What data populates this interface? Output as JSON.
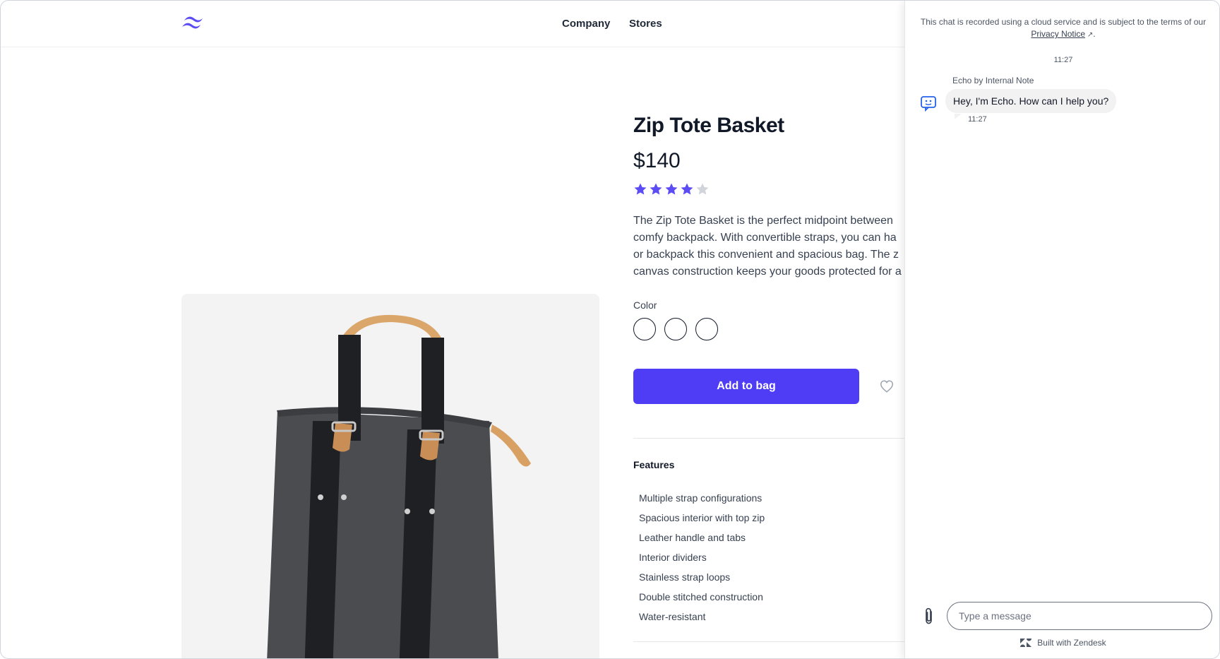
{
  "header": {
    "nav": [
      "Company",
      "Stores"
    ]
  },
  "product": {
    "title": "Zip Tote Basket",
    "price": "$140",
    "rating": 4,
    "rating_max": 5,
    "description_lines": [
      "The Zip Tote Basket is the perfect midpoint between",
      "comfy backpack. With convertible straps, you can ha",
      "or backpack this convenient and spacious bag. The z",
      "canvas construction keeps your goods protected for a"
    ],
    "color_label": "Color",
    "swatch_count": 3,
    "add_to_bag": "Add to bag",
    "features_title": "Features",
    "features": [
      "Multiple strap configurations",
      "Spacious interior with top zip",
      "Leather handle and tabs",
      "Interior dividers",
      "Stainless strap loops",
      "Double stitched construction",
      "Water-resistant"
    ],
    "icons": {
      "logo": "tailwind-logo-icon",
      "star": "star-icon",
      "favorite": "heart-icon"
    },
    "colors": {
      "accent": "#4f3cf5",
      "star_filled": "#5b4cf5",
      "star_empty": "#d1d5db"
    }
  },
  "chat": {
    "notice_text": "This chat is recorded using a cloud service and is subject to the terms of our",
    "notice_link": "Privacy Notice",
    "notice_end": ".",
    "timestamp": "11:27",
    "sender": "Echo by Internal Note",
    "message": "Hey, I'm Echo. How can I help you?",
    "message_time": "11:27",
    "input_placeholder": "Type a message",
    "powered_by": "Built with Zendesk",
    "icons": {
      "bot": "chat-bot-icon",
      "attach": "paperclip-icon",
      "zendesk": "zendesk-logo-icon"
    }
  }
}
